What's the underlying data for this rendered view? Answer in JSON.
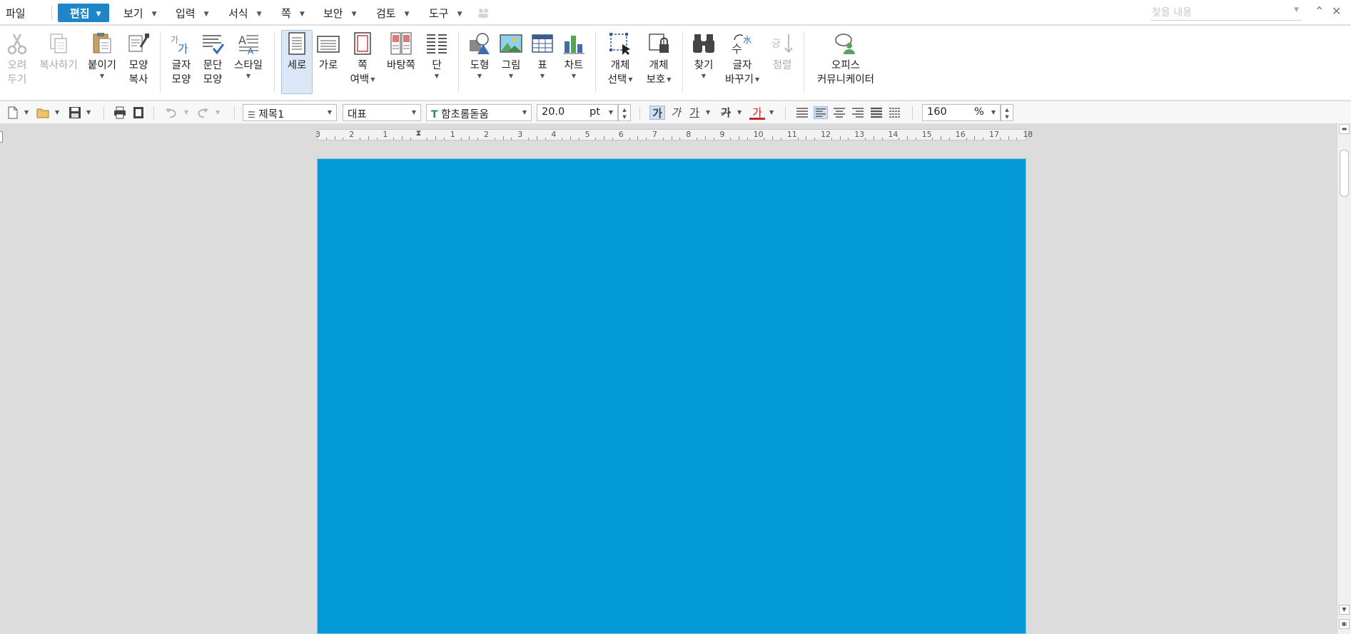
{
  "menu": {
    "file": "파일",
    "active": "편집",
    "items": [
      "보기",
      "입력",
      "서식",
      "쪽",
      "보안",
      "검토",
      "도구"
    ],
    "search_placeholder": "찾을 내용"
  },
  "ribbon": {
    "cut": [
      "오려",
      "두기"
    ],
    "copy": "복사하기",
    "paste": "붙이기",
    "format_copy": [
      "모양",
      "복사"
    ],
    "char_shape": [
      "글자",
      "모양"
    ],
    "para_shape": [
      "문단",
      "모양"
    ],
    "style": "스타일",
    "portrait": "세로",
    "landscape": "가로",
    "page_margin": [
      "쪽",
      "여백"
    ],
    "master_page": "바탕쪽",
    "column": "단",
    "shape": "도형",
    "picture": "그림",
    "table": "표",
    "chart": "차트",
    "object_select": [
      "개체",
      "선택"
    ],
    "object_protect": [
      "개체",
      "보호"
    ],
    "find": "찾기",
    "replace": [
      "글자",
      "바꾸기"
    ],
    "sort": "정렬",
    "office_comm": [
      "오피스",
      "커뮤니케이터"
    ]
  },
  "toolbar": {
    "style_name": "제목1",
    "lang": "대표",
    "font": "함초롬돋움",
    "font_size": "20.0",
    "unit": "pt",
    "zoom": "160",
    "zoom_unit": "%",
    "fmt_bold": "가",
    "fmt_italic": "가",
    "fmt_underline": "가",
    "fmt_strike": "가",
    "fmt_color": "가"
  },
  "ruler_numbers": [
    "3",
    "2",
    "1",
    "",
    "1",
    "2",
    "3",
    "4",
    "5",
    "6",
    "7",
    "8",
    "9",
    "10",
    "11",
    "12",
    "13",
    "14",
    "15",
    "16",
    "17",
    "18"
  ],
  "colors": {
    "accent": "#1e86c8",
    "page": "#0398d6",
    "selected": "#dbe7f6"
  }
}
